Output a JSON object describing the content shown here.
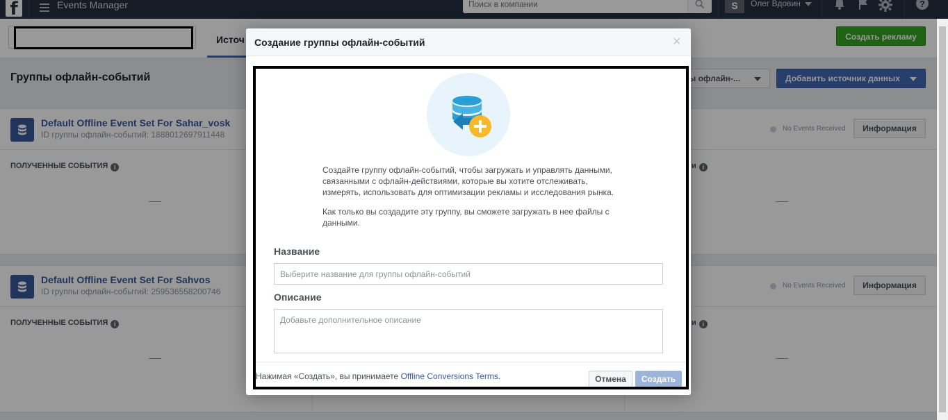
{
  "topbar": {
    "app_title": "Events Manager",
    "search_placeholder": "Поиск в компании",
    "user_initial": "S",
    "user_name": "Олег Вдовин",
    "help": "?"
  },
  "subheader": {
    "tab_sources": "Источ",
    "create_ad_label": "Создать рекламу"
  },
  "section": {
    "title": "Группы офлайн-событий",
    "filter_label": "ы офлайн-...",
    "add_source_label": "Добавить источник данных"
  },
  "cards": [
    {
      "name": "Default Offline Event Set For Sahar_vosk",
      "id": "ID группы офлайн-событий: 1888012697911448",
      "status": "No Events Received",
      "info_label": "Информация",
      "metric_label": "ПОЛУЧЕННЫЕ СОБЫТИЯ",
      "metric_label2": "и"
    },
    {
      "name": "Default Offline Event Set For Sahvos",
      "id": "ID группы офлайн-событий: 259536558200746",
      "status": "No Events Received",
      "info_label": "Информация",
      "metric_label": "ПОЛУЧЕННЫЕ СОБЫТИЯ",
      "metric_label2": "и"
    }
  ],
  "modal": {
    "title": "Создание группы офлайн-событий",
    "close": "×",
    "intro_1": "Создайте группу офлайн-событий, чтобы загружать и управлять данными, связанными с офлайн-действиями, которые вы хотите отслеживать, измерять, использовать для оптимизации рекламы и исследования рынка.",
    "intro_2": "Как только вы создадите эту группу, вы сможете загружать в нее файлы с данными.",
    "name_label": "Название",
    "name_placeholder": "Выберите название для группы офлайн-событий",
    "name_value": "",
    "desc_label": "Описание",
    "desc_placeholder": "Добавьте дополнительное описание",
    "desc_value": "",
    "terms_prefix": "Нажимая «Создать», вы принимаете ",
    "terms_link": "Offline Conversions Terms",
    "terms_suffix": ".",
    "cancel_label": "Отмена",
    "create_label": "Создать"
  },
  "colors": {
    "topbar": "#252f3f",
    "primary": "#4267b2",
    "link": "#365899",
    "success": "#36a420",
    "disabled_primary": "#9cb4d8"
  }
}
